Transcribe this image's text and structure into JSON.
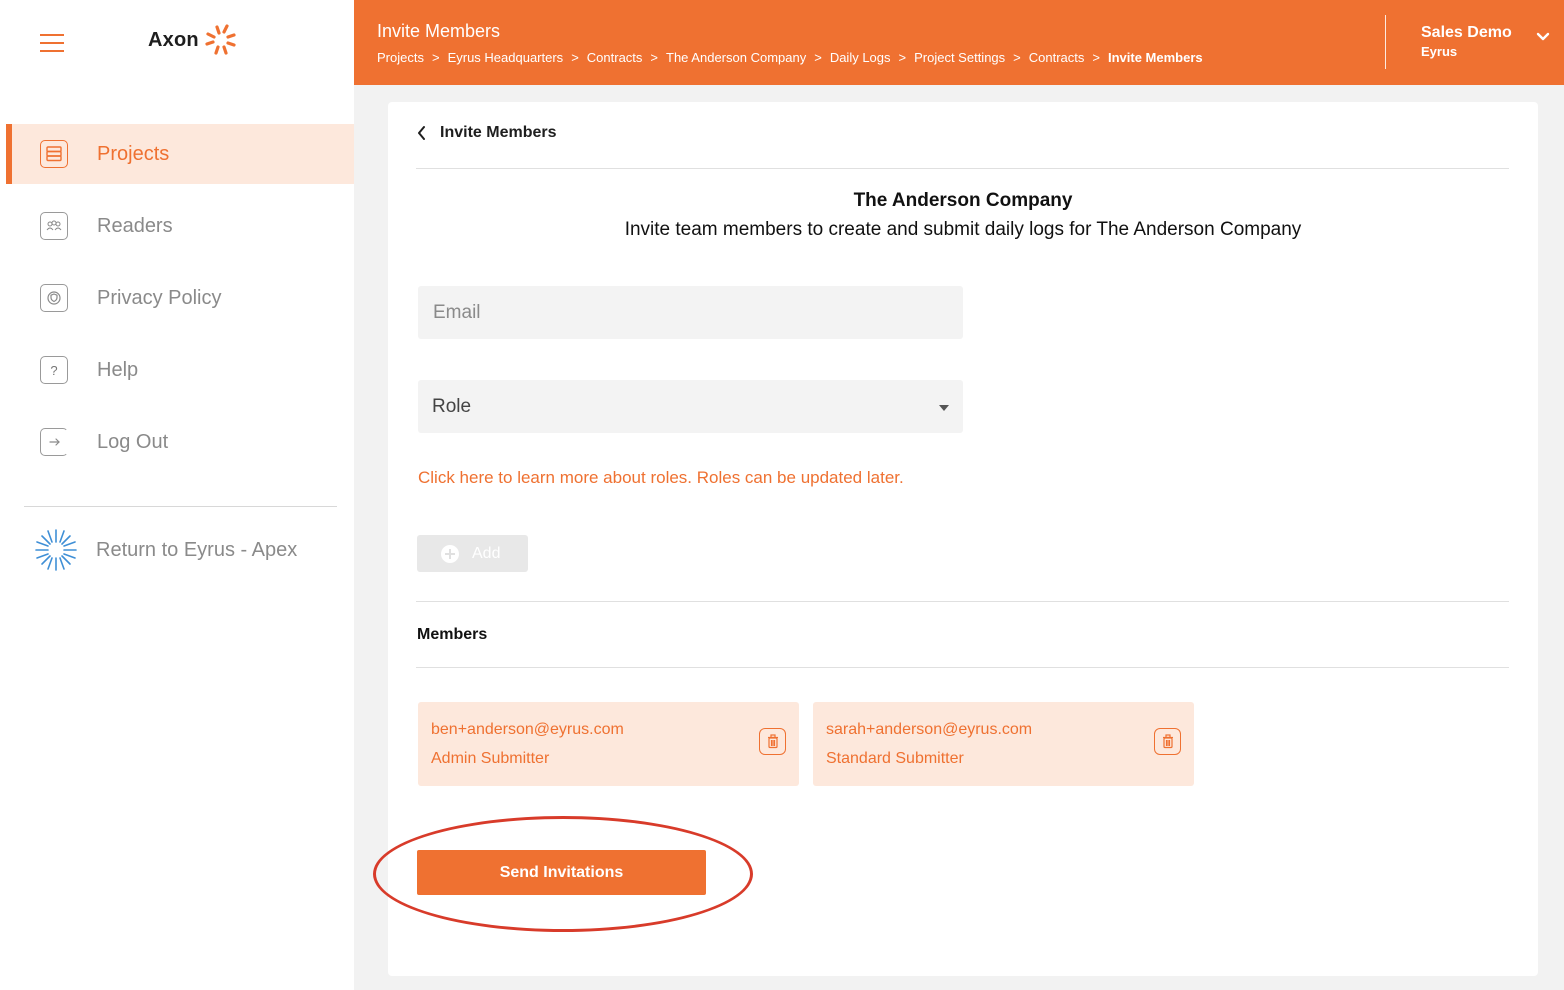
{
  "app": {
    "logo_text": "Axon",
    "accent_color": "#ef7131",
    "highlight_color": "#d83b2a"
  },
  "sidebar": {
    "items": [
      {
        "label": "Projects",
        "icon": "folder-stack-icon",
        "active": true
      },
      {
        "label": "Readers",
        "icon": "readers-icon",
        "active": false
      },
      {
        "label": "Privacy Policy",
        "icon": "shield-icon",
        "active": false
      },
      {
        "label": "Help",
        "icon": "help-icon",
        "active": false
      },
      {
        "label": "Log Out",
        "icon": "logout-icon",
        "active": false
      }
    ],
    "return_label": "Return to Eyrus - Apex"
  },
  "header": {
    "title": "Invite Members",
    "breadcrumb": [
      "Projects",
      "Eyrus Headquarters",
      "Contracts",
      "The Anderson Company",
      "Daily Logs",
      "Project Settings",
      "Contracts",
      "Invite Members"
    ],
    "separator": ">",
    "user_name": "Sales Demo",
    "user_org": "Eyrus"
  },
  "main": {
    "back_title": "Invite Members",
    "company_name": "The Anderson Company",
    "subtitle": "Invite team members to create and submit daily logs for The Anderson Company",
    "email_placeholder": "Email",
    "role_placeholder": "Role",
    "roles_link": "Click here to learn more about roles. Roles can be updated later.",
    "add_label": "Add",
    "members_title": "Members",
    "members": [
      {
        "email": "ben+anderson@eyrus.com",
        "role": "Admin Submitter"
      },
      {
        "email": "sarah+anderson@eyrus.com",
        "role": "Standard Submitter"
      }
    ],
    "send_label": "Send Invitations"
  }
}
